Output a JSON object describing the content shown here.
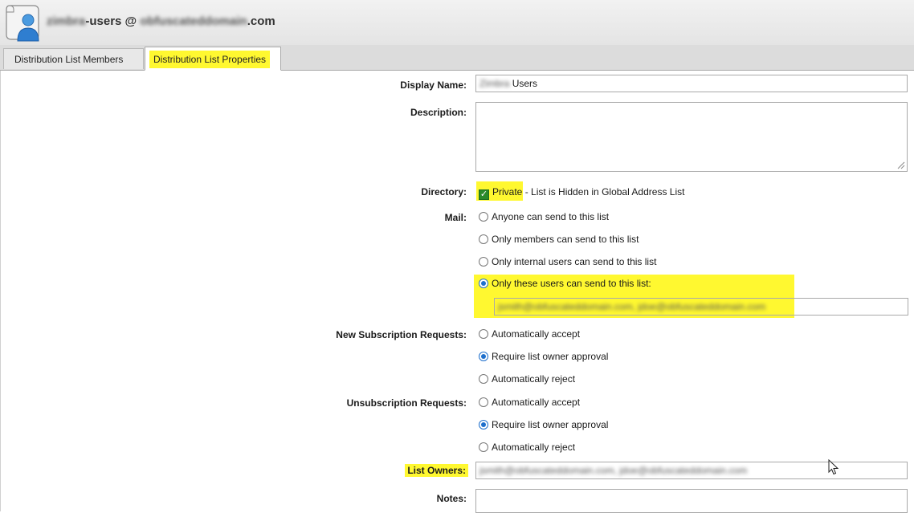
{
  "header": {
    "title_prefix": "zimbra",
    "title_mid": "-users @ ",
    "title_domain": "obfuscateddomain",
    "title_suffix": ".com",
    "icon": "distribution-list-user-icon"
  },
  "tabs": [
    {
      "label": "Distribution List Members",
      "active": false
    },
    {
      "label": "Distribution List Properties",
      "active": true
    }
  ],
  "form": {
    "display_name_label": "Display Name:",
    "display_name_blur": "Zimbra",
    "display_name_value": "Users",
    "description_label": "Description:",
    "description_value": "",
    "directory_label": "Directory:",
    "private_label": "Private",
    "private_desc": " - List is Hidden in Global Address List",
    "private_checked": true,
    "mail_label": "Mail:",
    "mail_options": [
      {
        "label": "Anyone can send to this list",
        "selected": false
      },
      {
        "label": "Only members can send to this list",
        "selected": false
      },
      {
        "label": "Only internal users can send to this list",
        "selected": false
      },
      {
        "label": "Only these users can send to this list:",
        "selected": true
      }
    ],
    "allowed_senders_value": "jsmith@obfuscateddomain.com, jdoe@obfuscateddomain.com",
    "subscription_label": "New Subscription Requests:",
    "subscription_options": [
      {
        "label": "Automatically accept",
        "selected": false
      },
      {
        "label": "Require list owner approval",
        "selected": true
      },
      {
        "label": "Automatically reject",
        "selected": false
      }
    ],
    "unsubscription_label": "Unsubscription Requests:",
    "unsubscription_options": [
      {
        "label": "Automatically accept",
        "selected": false
      },
      {
        "label": "Require list owner approval",
        "selected": true
      },
      {
        "label": "Automatically reject",
        "selected": false
      }
    ],
    "list_owners_label": "List Owners:",
    "list_owners_value": "jsmith@obfuscateddomain.com, jdoe@obfuscateddomain.com",
    "notes_label": "Notes:",
    "notes_value": ""
  },
  "colors": {
    "highlight": "#fff830",
    "radio_selected": "#1e6fcc",
    "checkbox": "#2a8a2a"
  }
}
